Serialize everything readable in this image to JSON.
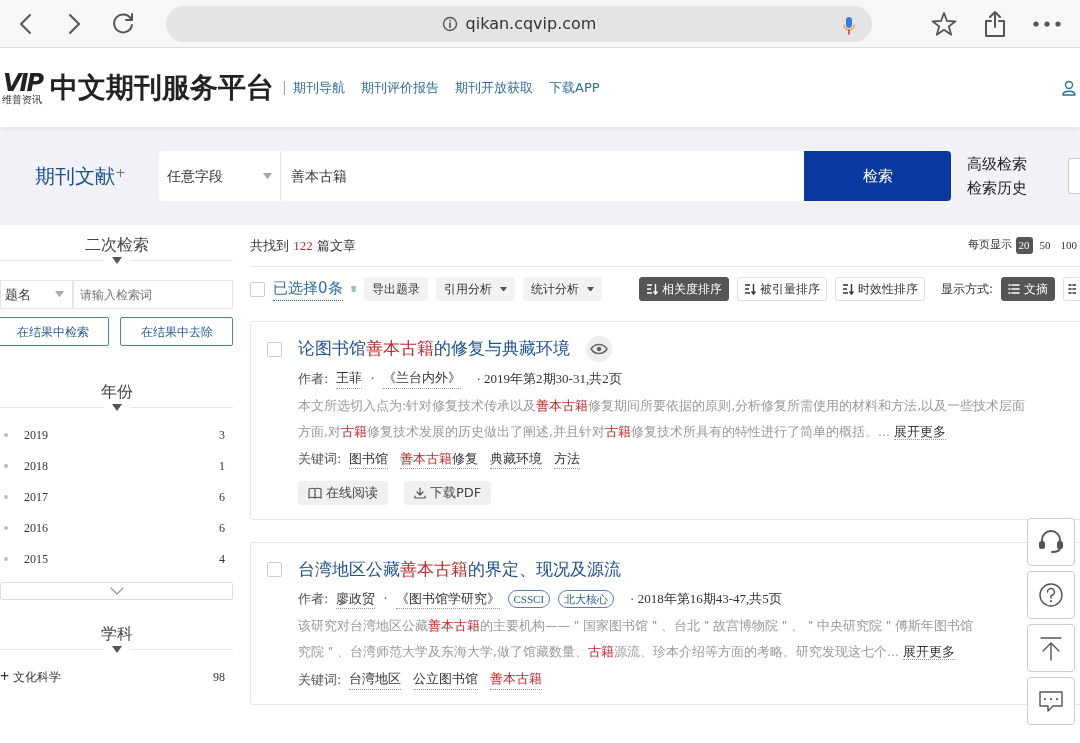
{
  "browser": {
    "url": "qikan.cqvip.com"
  },
  "header": {
    "logo_text": "VIP",
    "logo_sub": "维普资讯",
    "site_title": "中文期刊服务平台",
    "nav": [
      "期刊导航",
      "期刊评价报告",
      "期刊开放获取",
      "下载APP"
    ]
  },
  "search": {
    "category": "期刊文献",
    "category_mark": "+",
    "field": "任意字段",
    "query": "善本古籍",
    "button": "检索",
    "links": [
      "高级检索",
      "检索历史"
    ]
  },
  "sidebar": {
    "refine_title": "二次检索",
    "refine_field": "题名",
    "refine_placeholder": "请输入检索词",
    "refine_buttons": [
      "在结果中检索",
      "在结果中去除"
    ],
    "year_title": "年份",
    "years": [
      {
        "year": "2019",
        "count": "3"
      },
      {
        "year": "2018",
        "count": "1"
      },
      {
        "year": "2017",
        "count": "6"
      },
      {
        "year": "2016",
        "count": "6"
      },
      {
        "year": "2015",
        "count": "4"
      }
    ],
    "subject_title": "学科",
    "subjects": [
      {
        "mark": "+",
        "name": "文化科学",
        "count": "98"
      }
    ]
  },
  "summary": {
    "prefix": "共找到",
    "count": "122",
    "suffix": "篇文章",
    "per_page_label": "每页显示",
    "per_page": [
      {
        "label": "20",
        "selected": true
      },
      {
        "label": "50",
        "selected": false
      },
      {
        "label": "100",
        "selected": false
      }
    ]
  },
  "toolbar": {
    "selected_text": "已选择0条",
    "checked": false,
    "actions": [
      {
        "label": "导出题录",
        "dropdown": false
      },
      {
        "label": "引用分析",
        "dropdown": true
      },
      {
        "label": "统计分析",
        "dropdown": true
      }
    ],
    "sorts": [
      {
        "label": "相关度排序",
        "selected": true
      },
      {
        "label": "被引量排序",
        "selected": false
      },
      {
        "label": "时效性排序",
        "selected": false
      }
    ],
    "view_label": "显示方式:",
    "views": [
      {
        "label": "文摘",
        "selected": true
      }
    ]
  },
  "results": [
    {
      "checked": false,
      "title": [
        {
          "text": "论图书馆",
          "hl": false
        },
        {
          "text": "善本古籍",
          "hl": true
        },
        {
          "text": "的修复与典藏环境",
          "hl": false
        }
      ],
      "preview": true,
      "author_label": "作者:",
      "authors": [
        "王菲"
      ],
      "separator": "·",
      "journal": "《兰台内外》",
      "issue": "· 2019年第2期30-31,共2页",
      "abstract": [
        [
          {
            "text": "本文所选切入点为:针对修复技术传承以及",
            "hl": false
          },
          {
            "text": "善本古籍",
            "hl": true
          },
          {
            "text": "修复期间所要依据的原则,分析修复所需使用的材料和方法,以及一些技术层面",
            "hl": false
          }
        ],
        [
          {
            "text": "方面,对",
            "hl": false
          },
          {
            "text": "古籍",
            "hl": true
          },
          {
            "text": "修复技术发展的历史做出了阐述,并且针对",
            "hl": false
          },
          {
            "text": "古籍",
            "hl": true
          },
          {
            "text": "修复技术所具有的特性进行了简单的概括。...",
            "hl": false
          }
        ]
      ],
      "more": "展开更多",
      "keywords_label": "关键词:",
      "keywords": [
        [
          {
            "text": "图书馆",
            "hl": false
          }
        ],
        [
          {
            "text": "善本古籍",
            "hl": true
          },
          {
            "text": "修复",
            "hl": false
          }
        ],
        [
          {
            "text": "典藏环境",
            "hl": false
          }
        ],
        [
          {
            "text": "方法",
            "hl": false
          }
        ]
      ],
      "actions": [
        {
          "kind": "read",
          "label": "在线阅读"
        },
        {
          "kind": "download",
          "label": "下载PDF"
        }
      ]
    },
    {
      "checked": false,
      "title": [
        {
          "text": "台湾地区公藏",
          "hl": false
        },
        {
          "text": "善本古籍",
          "hl": true
        },
        {
          "text": "的界定、现况及源流",
          "hl": false
        }
      ],
      "preview": false,
      "author_label": "作者:",
      "authors": [
        "廖政贸"
      ],
      "separator": "·",
      "journal": "《图书馆学研究》",
      "tags": [
        "CSSCI",
        "北大核心"
      ],
      "issue": "· 2018年第16期43-47,共5页",
      "abstract": [
        [
          {
            "text": "该研究对台湾地区公藏",
            "hl": false
          },
          {
            "text": "善本古籍",
            "hl": true
          },
          {
            "text": "的主要机构——＂国家图书馆＂、台北＂故宫博物院＂、＂中央研究院＂傅斯年图书馆",
            "hl": false
          }
        ],
        [
          {
            "text": "究院＂、台湾师范大学及东海大学,做了馆藏数量、",
            "hl": false
          },
          {
            "text": "古籍",
            "hl": true
          },
          {
            "text": "源流、珍本介绍等方面的考略。研究发现这七个...",
            "hl": false
          }
        ]
      ],
      "more": "展开更多",
      "keywords_label": "关键词:",
      "keywords": [
        [
          {
            "text": "台湾地区",
            "hl": false
          }
        ],
        [
          {
            "text": "公立图书馆",
            "hl": false
          }
        ],
        [
          {
            "text": "善本古籍",
            "hl": true
          }
        ]
      ]
    }
  ],
  "float_buttons": [
    {
      "kind": "headset"
    },
    {
      "kind": "help"
    },
    {
      "kind": "top"
    },
    {
      "kind": "chat"
    }
  ]
}
